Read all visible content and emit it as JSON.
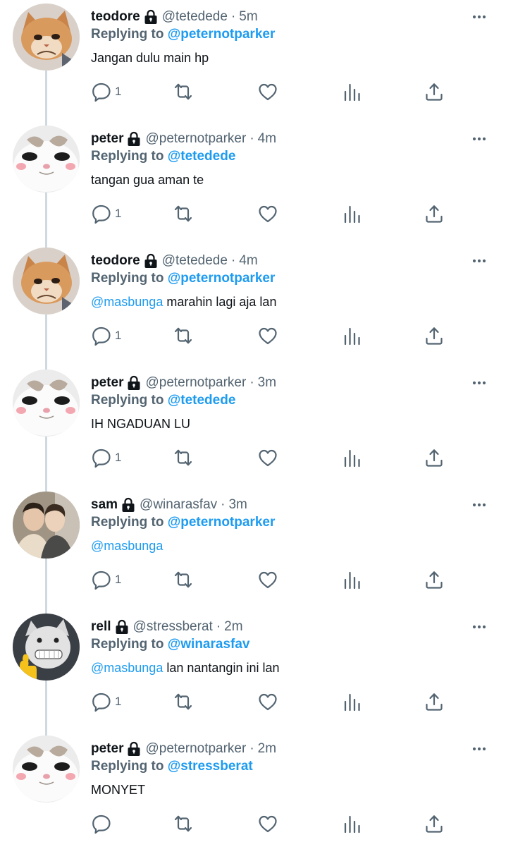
{
  "tweets": [
    {
      "avatar": "orange-cat-avatar",
      "name": "teodore",
      "handle": "@tetedede",
      "time": "5m",
      "replying_to_label": "Replying to",
      "replying_to": "@peternotparker",
      "text_mention": "",
      "text": "Jangan dulu main hp",
      "reply_count": "1"
    },
    {
      "avatar": "white-cat-avatar",
      "name": "peter",
      "handle": "@peternotparker",
      "time": "4m",
      "replying_to_label": "Replying to",
      "replying_to": "@tetedede",
      "text_mention": "",
      "text": "tangan gua aman te",
      "reply_count": "1"
    },
    {
      "avatar": "orange-cat-avatar",
      "name": "teodore",
      "handle": "@tetedede",
      "time": "4m",
      "replying_to_label": "Replying to",
      "replying_to": "@peternotparker",
      "text_mention": "@masbunga",
      "text": "marahin lagi aja lan",
      "reply_count": "1"
    },
    {
      "avatar": "white-cat-avatar",
      "name": "peter",
      "handle": "@peternotparker",
      "time": "3m",
      "replying_to_label": "Replying to",
      "replying_to": "@tetedede",
      "text_mention": "",
      "text": "IH NGADUAN LU",
      "reply_count": "1"
    },
    {
      "avatar": "two-people-avatar",
      "name": "sam",
      "handle": "@winarasfav",
      "time": "3m",
      "replying_to_label": "Replying to",
      "replying_to": "@peternotparker",
      "text_mention": "@masbunga",
      "text": "",
      "reply_count": "1"
    },
    {
      "avatar": "grinning-cat-thumbs-up-avatar",
      "name": "rell",
      "handle": "@stressberat",
      "time": "2m",
      "replying_to_label": "Replying to",
      "replying_to": "@winarasfav",
      "text_mention": "@masbunga",
      "text": "lan nantangin ini lan",
      "reply_count": "1"
    },
    {
      "avatar": "white-cat-avatar",
      "name": "peter",
      "handle": "@peternotparker",
      "time": "2m",
      "replying_to_label": "Replying to",
      "replying_to": "@stressberat",
      "text_mention": "",
      "text": "MONYET",
      "reply_count": ""
    }
  ],
  "separator": "·",
  "icons": {
    "lock": "lock-icon",
    "more": "more-icon",
    "reply": "reply-icon",
    "retweet": "retweet-icon",
    "like": "like-icon",
    "stats": "stats-icon",
    "share": "share-icon"
  },
  "colors": {
    "name": "#0f1419",
    "secondary": "#536471",
    "mention": "#1d9bf0",
    "thread_line": "#cfd9de"
  }
}
